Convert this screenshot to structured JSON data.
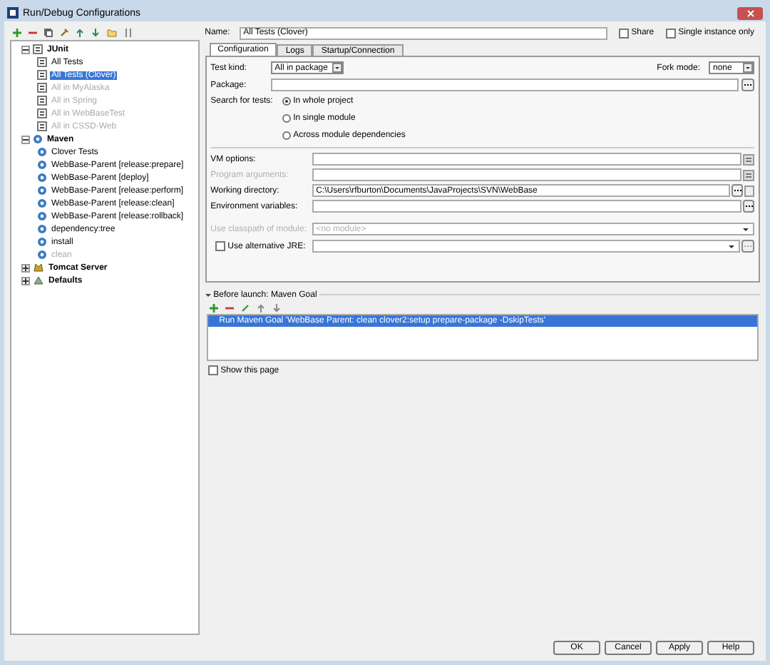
{
  "window": {
    "title": "Run/Debug Configurations"
  },
  "tree": [
    {
      "label": "JUnit",
      "kind": "junit",
      "expanded": true,
      "disabled": false,
      "selected": false,
      "children": [
        {
          "label": "All Tests",
          "kind": "junit",
          "disabled": false,
          "selected": false
        },
        {
          "label": "All Tests (Clover)",
          "kind": "junit",
          "disabled": false,
          "selected": true
        },
        {
          "label": "All in MyAlaska",
          "kind": "junit",
          "disabled": true,
          "selected": false
        },
        {
          "label": "All in Spring",
          "kind": "junit",
          "disabled": true,
          "selected": false
        },
        {
          "label": "All in WebBaseTest",
          "kind": "junit",
          "disabled": true,
          "selected": false
        },
        {
          "label": "All in CSSD-Web",
          "kind": "junit",
          "disabled": true,
          "selected": false
        }
      ]
    },
    {
      "label": "Maven",
      "kind": "maven",
      "expanded": true,
      "disabled": false,
      "selected": false,
      "children": [
        {
          "label": "Clover Tests",
          "kind": "maven",
          "disabled": false,
          "selected": false
        },
        {
          "label": "WebBase-Parent [release:prepare]",
          "kind": "maven",
          "disabled": false,
          "selected": false
        },
        {
          "label": "WebBase-Parent [deploy]",
          "kind": "maven",
          "disabled": false,
          "selected": false
        },
        {
          "label": "WebBase-Parent [release:perform]",
          "kind": "maven",
          "disabled": false,
          "selected": false
        },
        {
          "label": "WebBase-Parent [release:clean]",
          "kind": "maven",
          "disabled": false,
          "selected": false
        },
        {
          "label": "WebBase-Parent [release:rollback]",
          "kind": "maven",
          "disabled": false,
          "selected": false
        },
        {
          "label": "dependency:tree",
          "kind": "maven",
          "disabled": false,
          "selected": false
        },
        {
          "label": "install",
          "kind": "maven",
          "disabled": false,
          "selected": false
        },
        {
          "label": "clean",
          "kind": "maven",
          "disabled": true,
          "selected": false
        }
      ]
    },
    {
      "label": "Tomcat Server",
      "kind": "tomcat",
      "expanded": false,
      "disabled": false,
      "selected": false
    },
    {
      "label": "Defaults",
      "kind": "defaults",
      "expanded": false,
      "disabled": false,
      "selected": false
    }
  ],
  "name": {
    "label": "Name:",
    "value": "All Tests (Clover)"
  },
  "options": [
    {
      "label": "Share",
      "checked": false
    },
    {
      "label": "Single instance only",
      "checked": false
    }
  ],
  "tabs": [
    {
      "label": "Configuration",
      "selected": true
    },
    {
      "label": "Logs",
      "selected": false
    },
    {
      "label": "Startup/Connection",
      "selected": false
    }
  ],
  "test_kind": {
    "label": "Test kind:",
    "value": "All in package"
  },
  "fork_mode": {
    "label": "Fork mode:",
    "value": "none"
  },
  "package": {
    "label": "Package:"
  },
  "search": {
    "label": "Search for tests:",
    "choices": [
      {
        "label": "In whole project",
        "selected": true
      },
      {
        "label": "In single module",
        "selected": false
      },
      {
        "label": "Across module dependencies",
        "selected": false
      }
    ]
  },
  "fields": [
    {
      "label": "VM options:",
      "disabled": false,
      "kind": "expand"
    },
    {
      "label": "Program arguments:",
      "disabled": true,
      "kind": "expand"
    },
    {
      "label": "Working directory:",
      "value": "C:\\Users\\rfburton\\Documents\\JavaProjects\\SVN\\WebBase",
      "disabled": false,
      "kind": "browse"
    },
    {
      "label": "Environment variables:",
      "disabled": false,
      "kind": "dots"
    }
  ],
  "module": {
    "label": "Use classpath of module:",
    "value": "<no module>",
    "disabled": true
  },
  "alt_jre": {
    "label": "Use alternative JRE:",
    "checked": false
  },
  "before_launch": {
    "title": "Before launch: Maven Goal",
    "expanded": true,
    "items": [
      {
        "label": "Run Maven Goal 'WebBase Parent: clean clover2:setup prepare-package -DskipTests'",
        "selected": true
      }
    ]
  },
  "show_page": {
    "label": "Show this page",
    "checked": false
  },
  "buttons": [
    "OK",
    "Cancel",
    "Apply",
    "Help"
  ]
}
